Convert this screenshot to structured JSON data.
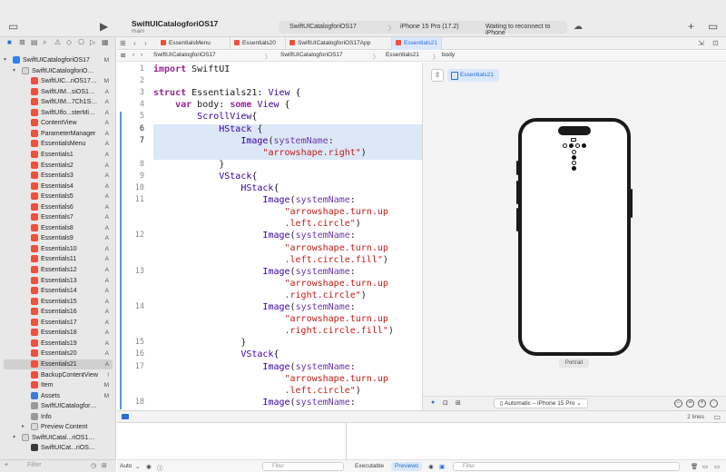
{
  "toolbar": {
    "project_title": "SwiftUICatalogforiOS17",
    "branch": "main",
    "scheme": "SwiftUICatalogforiOS17",
    "destination": "iPhone 15 Pro (17.2)",
    "status": "Waiting to reconnect to iPhone",
    "run_icon": "play-icon",
    "add_icon": "plus-icon"
  },
  "navigator": {
    "filter_placeholder": "Filter",
    "items": [
      {
        "label": "SwiftUICatalogforiOS17",
        "badge": "M",
        "kind": "proj",
        "indent": 0,
        "disclosure": "▾"
      },
      {
        "label": "SwiftUICatalogforiOS17",
        "badge": "",
        "kind": "folder",
        "indent": 1,
        "disclosure": "▾"
      },
      {
        "label": "SwiftUIC...riOS17App",
        "badge": "M",
        "kind": "swift",
        "indent": 2,
        "disclosure": ""
      },
      {
        "label": "SwiftUIM...siOS17Ch1",
        "badge": "A",
        "kind": "swift",
        "indent": 2,
        "disclosure": ""
      },
      {
        "label": "SwiftUIM...7Ch1Sec1",
        "badge": "A",
        "kind": "swift",
        "indent": 2,
        "disclosure": ""
      },
      {
        "label": "SwiftUIfo...sterMinds",
        "badge": "A",
        "kind": "swift",
        "indent": 2,
        "disclosure": ""
      },
      {
        "label": "ContentView",
        "badge": "A",
        "kind": "swift",
        "indent": 2,
        "disclosure": ""
      },
      {
        "label": "ParameterManager",
        "badge": "A",
        "kind": "swift",
        "indent": 2,
        "disclosure": ""
      },
      {
        "label": "EssentialsMenu",
        "badge": "A",
        "kind": "swift",
        "indent": 2,
        "disclosure": ""
      },
      {
        "label": "Essentials1",
        "badge": "A",
        "kind": "swift",
        "indent": 2,
        "disclosure": ""
      },
      {
        "label": "Essentials2",
        "badge": "A",
        "kind": "swift",
        "indent": 2,
        "disclosure": ""
      },
      {
        "label": "Essentials3",
        "badge": "A",
        "kind": "swift",
        "indent": 2,
        "disclosure": ""
      },
      {
        "label": "Essentials4",
        "badge": "A",
        "kind": "swift",
        "indent": 2,
        "disclosure": ""
      },
      {
        "label": "Essentials5",
        "badge": "A",
        "kind": "swift",
        "indent": 2,
        "disclosure": ""
      },
      {
        "label": "Essentials6",
        "badge": "A",
        "kind": "swift",
        "indent": 2,
        "disclosure": ""
      },
      {
        "label": "Essentials7",
        "badge": "A",
        "kind": "swift",
        "indent": 2,
        "disclosure": ""
      },
      {
        "label": "Essentials8",
        "badge": "A",
        "kind": "swift",
        "indent": 2,
        "disclosure": ""
      },
      {
        "label": "Essentials9",
        "badge": "A",
        "kind": "swift",
        "indent": 2,
        "disclosure": ""
      },
      {
        "label": "Essentials10",
        "badge": "A",
        "kind": "swift",
        "indent": 2,
        "disclosure": ""
      },
      {
        "label": "Essentials11",
        "badge": "A",
        "kind": "swift",
        "indent": 2,
        "disclosure": ""
      },
      {
        "label": "Essentials12",
        "badge": "A",
        "kind": "swift",
        "indent": 2,
        "disclosure": ""
      },
      {
        "label": "Essentials13",
        "badge": "A",
        "kind": "swift",
        "indent": 2,
        "disclosure": ""
      },
      {
        "label": "Essentials14",
        "badge": "A",
        "kind": "swift",
        "indent": 2,
        "disclosure": ""
      },
      {
        "label": "Essentials15",
        "badge": "A",
        "kind": "swift",
        "indent": 2,
        "disclosure": ""
      },
      {
        "label": "Essentials16",
        "badge": "A",
        "kind": "swift",
        "indent": 2,
        "disclosure": ""
      },
      {
        "label": "Essentials17",
        "badge": "A",
        "kind": "swift",
        "indent": 2,
        "disclosure": ""
      },
      {
        "label": "Essentials18",
        "badge": "A",
        "kind": "swift",
        "indent": 2,
        "disclosure": ""
      },
      {
        "label": "Essentials19",
        "badge": "A",
        "kind": "swift",
        "indent": 2,
        "disclosure": ""
      },
      {
        "label": "Essentials20",
        "badge": "A",
        "kind": "swift",
        "indent": 2,
        "disclosure": ""
      },
      {
        "label": "Essentials21",
        "badge": "A",
        "kind": "swift",
        "indent": 2,
        "disclosure": "",
        "selected": true
      },
      {
        "label": "BackupContentView",
        "badge": "!",
        "kind": "swift",
        "indent": 2,
        "disclosure": ""
      },
      {
        "label": "Item",
        "badge": "M",
        "kind": "swift",
        "indent": 2,
        "disclosure": ""
      },
      {
        "label": "Assets",
        "badge": "M",
        "kind": "assets",
        "indent": 2,
        "disclosure": ""
      },
      {
        "label": "SwiftUICatalogforiOS17",
        "badge": "",
        "kind": "plist",
        "indent": 2,
        "disclosure": ""
      },
      {
        "label": "Info",
        "badge": "",
        "kind": "plist",
        "indent": 2,
        "disclosure": ""
      },
      {
        "label": "Preview Content",
        "badge": "",
        "kind": "folder",
        "indent": 2,
        "disclosure": "▸"
      },
      {
        "label": "SwiftUICatal...riOS17Tests",
        "badge": "",
        "kind": "folder",
        "indent": 1,
        "disclosure": "▾"
      },
      {
        "label": "SwiftUICat...riOS17Tests",
        "badge": "",
        "kind": "test",
        "indent": 2,
        "disclosure": ""
      }
    ]
  },
  "tabs": [
    {
      "label": "EssentialsMenu",
      "active": false
    },
    {
      "label": "Essentials20",
      "active": false
    },
    {
      "label": "SwiftUICatalogforiOS17App",
      "active": false
    },
    {
      "label": "Essentials21",
      "active": true
    }
  ],
  "jumpbar": [
    "SwiftUICatalogforiOS17",
    "SwiftUICatalogforiOS17",
    "Essentials21",
    "body"
  ],
  "code_lines": [
    {
      "n": "1",
      "html": "<span class=\"kw\">import</span> SwiftUI"
    },
    {
      "n": "2",
      "html": ""
    },
    {
      "n": "3",
      "html": "<span class=\"kw\">struct</span> Essentials21: <span class=\"ty\">View</span> {"
    },
    {
      "n": "4",
      "html": "    <span class=\"kw\">var</span> body: <span class=\"kw\">some</span> <span class=\"ty\">View</span> {"
    },
    {
      "n": "5",
      "html": "        <span class=\"ty\">ScrollView</span>{"
    },
    {
      "n": "6",
      "html": "            <span class=\"ty\">HStack</span> {"
    },
    {
      "n": "7",
      "html": "                <span class=\"ty\">Image</span>(<span class=\"pl\">systemName</span>:"
    },
    {
      "n": "",
      "html": "                    <span class=\"st\">\"arrowshape.right\"</span>)"
    },
    {
      "n": "8",
      "html": "            }"
    },
    {
      "n": "9",
      "html": "            <span class=\"ty\">VStack</span>{"
    },
    {
      "n": "10",
      "html": "                <span class=\"ty\">HStack</span>{"
    },
    {
      "n": "11",
      "html": "                    <span class=\"ty\">Image</span>(<span class=\"pl\">systemName</span>:"
    },
    {
      "n": "",
      "html": "                        <span class=\"st\">\"arrowshape.turn.up</span>"
    },
    {
      "n": "",
      "html": "                        <span class=\"st\">.left.circle\"</span>)"
    },
    {
      "n": "12",
      "html": "                    <span class=\"ty\">Image</span>(<span class=\"pl\">systemName</span>:"
    },
    {
      "n": "",
      "html": "                        <span class=\"st\">\"arrowshape.turn.up</span>"
    },
    {
      "n": "",
      "html": "                        <span class=\"st\">.left.circle.fill\"</span>)"
    },
    {
      "n": "13",
      "html": "                    <span class=\"ty\">Image</span>(<span class=\"pl\">systemName</span>:"
    },
    {
      "n": "",
      "html": "                        <span class=\"st\">\"arrowshape.turn.up</span>"
    },
    {
      "n": "",
      "html": "                        <span class=\"st\">.right.circle\"</span>)"
    },
    {
      "n": "14",
      "html": "                    <span class=\"ty\">Image</span>(<span class=\"pl\">systemName</span>:"
    },
    {
      "n": "",
      "html": "                        <span class=\"st\">\"arrowshape.turn.up</span>"
    },
    {
      "n": "",
      "html": "                        <span class=\"st\">.right.circle.fill\"</span>)"
    },
    {
      "n": "15",
      "html": "                }"
    },
    {
      "n": "16",
      "html": "                <span class=\"ty\">VStack</span>{"
    },
    {
      "n": "17",
      "html": "                    <span class=\"ty\">Image</span>(<span class=\"pl\">systemName</span>:"
    },
    {
      "n": "",
      "html": "                        <span class=\"st\">\"arrowshape.turn.up</span>"
    },
    {
      "n": "",
      "html": "                        <span class=\"st\">.left.circle\"</span>)"
    },
    {
      "n": "18",
      "html": "                    <span class=\"ty\">Image</span>(<span class=\"pl\">systemName</span>:"
    }
  ],
  "current_lines": [
    "6",
    "7"
  ],
  "canvas": {
    "preview_label": "Essentials21",
    "orientation_label": "Portrait",
    "device_label": "Automatic – iPhone 15 Pro",
    "lines_count": "2 lines"
  },
  "debug": {
    "auto_label": "Auto",
    "filter_placeholder": "Filter",
    "executable_label": "Executable",
    "previews_label": "Previews"
  },
  "colors": {
    "accent": "#2a6fd6",
    "swift": "#f05138",
    "highlight": "#dce7f8"
  }
}
